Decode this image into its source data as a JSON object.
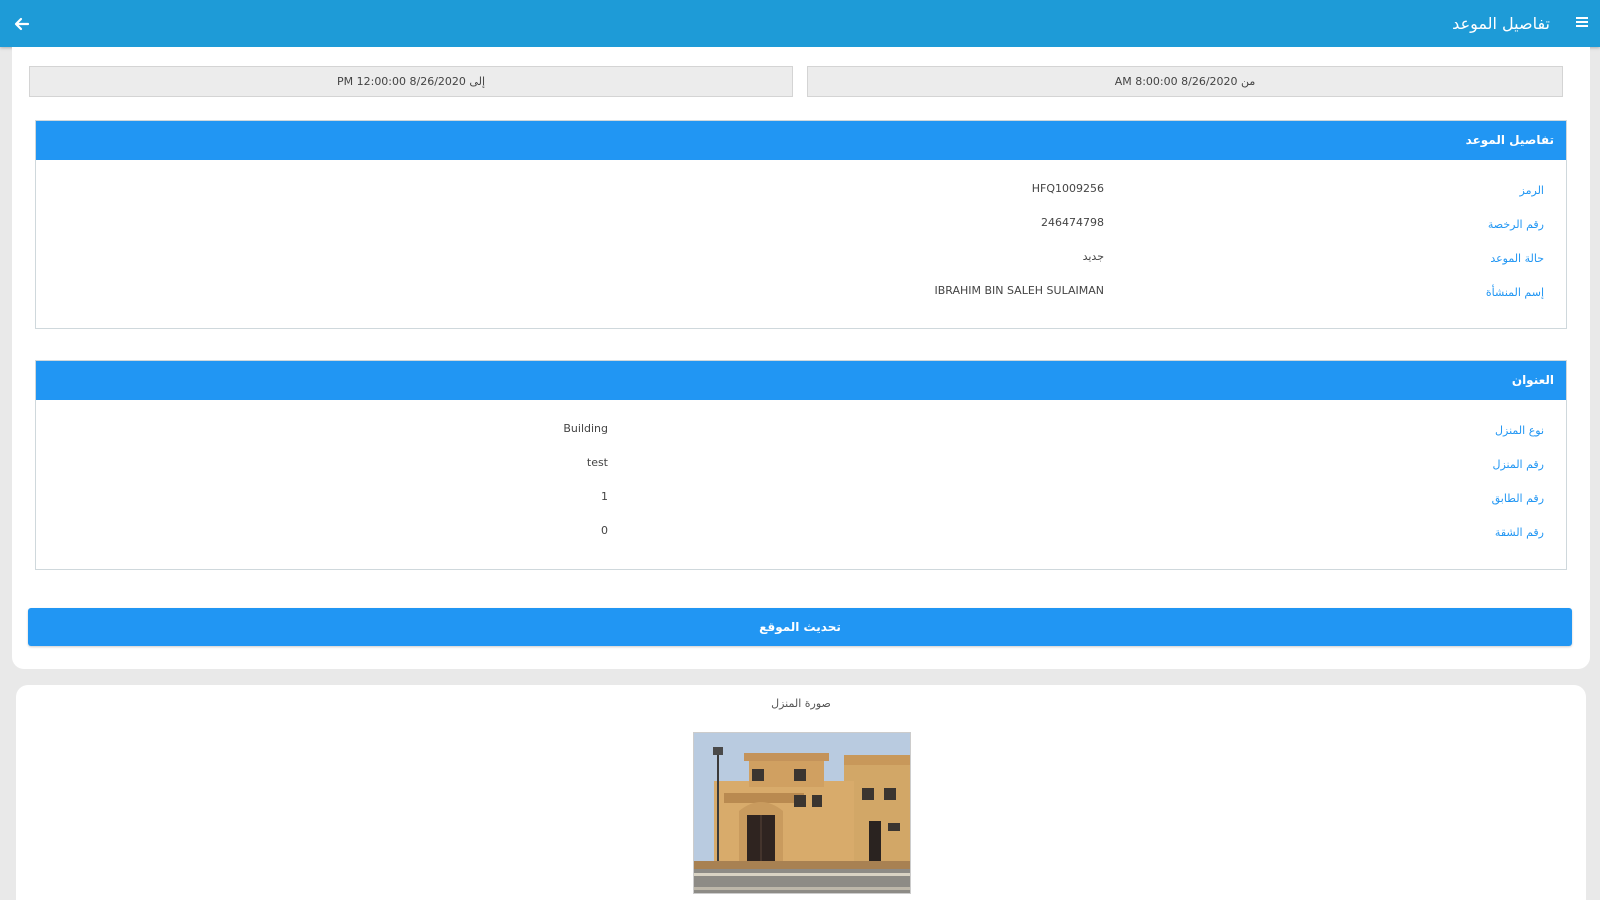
{
  "header": {
    "title": "تفاصيل الموعد"
  },
  "dates": {
    "from": "من 8/26/2020 8:00:00 AM",
    "to": "إلى 8/26/2020 12:00:00 PM"
  },
  "appointment_section": {
    "title": "تفاصيل الموعد",
    "rows": [
      {
        "label": "الرمز",
        "value": "HFQ1009256"
      },
      {
        "label": "رقم الرخصة",
        "value": "246474798"
      },
      {
        "label": "حالة الموعد",
        "value": "جديد"
      },
      {
        "label": "إسم المنشأة",
        "value": "IBRAHIM BIN SALEH SULAIMAN"
      }
    ]
  },
  "address_section": {
    "title": "العنوان",
    "rows": [
      {
        "label": "نوع المنزل",
        "value": "Building"
      },
      {
        "label": "رقم المنزل",
        "value": "test"
      },
      {
        "label": "رقم الطابق",
        "value": "1"
      },
      {
        "label": "رقم الشقة",
        "value": "0"
      }
    ]
  },
  "actions": {
    "update_location": "تحديث الموقع"
  },
  "photo": {
    "label": "صورة المنزل"
  },
  "colors": {
    "appbar": "#1e9bd7",
    "section_header": "#2196f3",
    "label": "#2196f3",
    "background": "#e9e9e9"
  }
}
